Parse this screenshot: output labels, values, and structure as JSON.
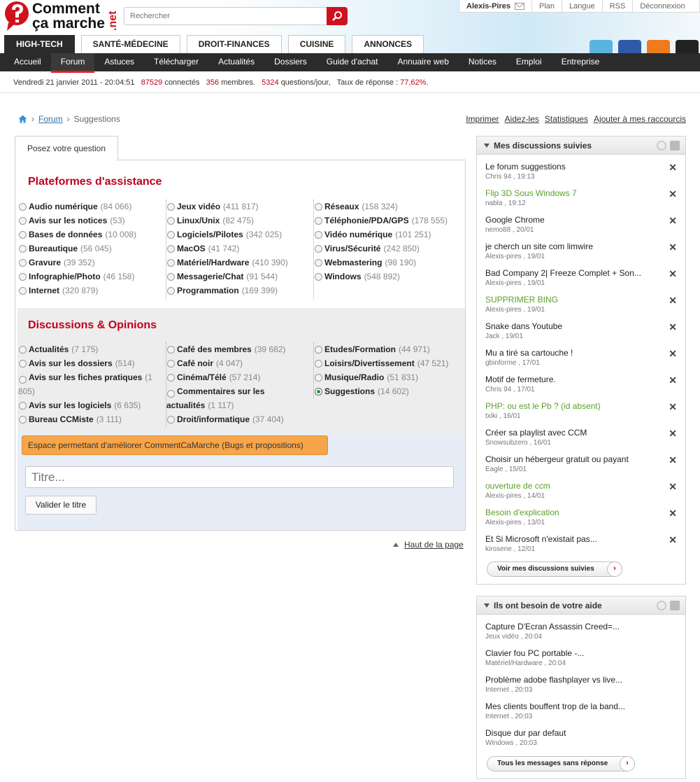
{
  "brand": {
    "line1": "Comment",
    "line2": "ça marche",
    ".net": ".net",
    "suffix": ".net"
  },
  "search": {
    "placeholder": "Rechercher"
  },
  "usermenu": {
    "user": "Alexis-Pires",
    "plan": "Plan",
    "langue": "Langue",
    "rss": "RSS",
    "logout": "Déconnexion"
  },
  "tabs": [
    "HIGH-TECH",
    "SANTÉ-MÉDECINE",
    "DROIT-FINANCES",
    "CUISINE",
    "ANNONCES"
  ],
  "nav": [
    "Accueil",
    "Forum",
    "Astuces",
    "Télécharger",
    "Actualités",
    "Dossiers",
    "Guide d'achat",
    "Annuaire web",
    "Notices",
    "Emploi",
    "Entreprise"
  ],
  "stats": {
    "date": "Vendredi 21 janvier 2011 - 20:04:51",
    "connected_n": "87529",
    "connected_l": "connectés",
    "members_n": "356",
    "members_l": "membres.",
    "q_n": "5324",
    "q_l": "questions/jour,",
    "rate_l": "Taux de réponse :",
    "rate_v": "77,62%."
  },
  "breadcrumb": {
    "forum": "Forum",
    "current": "Suggestions"
  },
  "tools": {
    "print": "Imprimer",
    "help": "Aidez-les",
    "stats": "Statistiques",
    "shortcut": "Ajouter à mes raccourcis"
  },
  "question_tab": "Posez votre question",
  "platforms": {
    "title": "Plateformes d'assistance",
    "cols": [
      [
        [
          "Audio numérique",
          "(84 066)"
        ],
        [
          "Avis sur les notices",
          "(53)"
        ],
        [
          "Bases de données",
          "(10 008)"
        ],
        [
          "Bureautique",
          "(56 045)"
        ],
        [
          "Gravure",
          "(39 352)"
        ],
        [
          "Infographie/Photo",
          "(46 158)"
        ],
        [
          "Internet",
          "(320 879)"
        ]
      ],
      [
        [
          "Jeux vidéo",
          "(411 817)"
        ],
        [
          "Linux/Unix",
          "(82 475)"
        ],
        [
          "Logiciels/Pilotes",
          "(342 025)"
        ],
        [
          "MacOS",
          "(41 742)"
        ],
        [
          "Matériel/Hardware",
          "(410 390)"
        ],
        [
          "Messagerie/Chat",
          "(91 544)"
        ],
        [
          "Programmation",
          "(169 399)"
        ]
      ],
      [
        [
          "Réseaux",
          "(158 324)"
        ],
        [
          "Téléphonie/PDA/GPS",
          "(178 555)"
        ],
        [
          "Vidéo numérique",
          "(101 251)"
        ],
        [
          "Virus/Sécurité",
          "(242 850)"
        ],
        [
          "Webmastering",
          "(98 190)"
        ],
        [
          "Windows",
          "(548 892)"
        ]
      ]
    ]
  },
  "discussions": {
    "title": "Discussions & Opinions",
    "c1": [
      [
        "Actualités",
        "(7 175)"
      ],
      [
        "Avis sur les dossiers",
        "(514)"
      ]
    ],
    "c1wrap": [
      "Avis sur les fiches pratiques",
      "(1 805)"
    ],
    "c1b": [
      [
        "Avis sur les logiciels",
        "(6 635)"
      ],
      [
        "Bureau CCMiste",
        "(3 111)"
      ]
    ],
    "c2": [
      [
        "Café des membres",
        "(39 682)"
      ],
      [
        "Café noir",
        "(4 047)"
      ],
      [
        "Cinéma/Télé",
        "(57 214)"
      ]
    ],
    "c2wrap": [
      "Commentaires sur les actualités",
      "(1 117)"
    ],
    "c2b": [
      [
        "Droit/informatique",
        "(37 404)"
      ]
    ],
    "c3": [
      [
        "Etudes/Formation",
        "(44 971)"
      ],
      [
        "Loisirs/Divertissement",
        "(47 521)"
      ],
      [
        "Musique/Radio",
        "(51 831)"
      ]
    ],
    "c3sel": [
      "Suggestions",
      "(14 602)"
    ]
  },
  "orange": "Espace permettant d'améliorer CommentCaMarche (Bugs et propositions)",
  "titre_placeholder": "Titre...",
  "valider": "Valider le titre",
  "haut": "Haut de la page",
  "followed": {
    "title": "Mes discussions suivies",
    "items": [
      [
        "Le forum suggestions",
        "Chris 94 , 19:13",
        false
      ],
      [
        "Flip 3D Sous Windows 7",
        "nabla , 19:12",
        true
      ],
      [
        "Google Chrome",
        "nemo88 , 20/01",
        false
      ],
      [
        "je cherch un site com limwire",
        "Alexis-pires , 19/01",
        false
      ],
      [
        "Bad Company 2| Freeze Complet + Son...",
        "Alexis-pires , 19/01",
        false
      ],
      [
        "SUPPRIMER BING",
        "Alexis-pires , 19/01",
        true
      ],
      [
        "Snake dans Youtube",
        "Jack , 19/01",
        false
      ],
      [
        "Mu a tiré sa cartouche !",
        "gbinforme , 17/01",
        false
      ],
      [
        "Motif de fermeture.",
        "Chris 94 , 17/01",
        false
      ],
      [
        "PHP: ou est le Pb ? (id absent)",
        "txiki , 16/01",
        true
      ],
      [
        "Créer sa playlist avec CCM",
        "Snowsubzero , 16/01",
        false
      ],
      [
        "Choisir un hébergeur gratuit ou payant",
        "Eagle , 15/01",
        false
      ],
      [
        "ouverture de ccm",
        "Alexis-pires , 14/01",
        true
      ],
      [
        "Besoin d'explication",
        "Alexis-pires , 13/01",
        true
      ],
      [
        "Et Si Microsoft n'existait pas...",
        "kirosene , 12/01",
        false
      ]
    ],
    "button": "Voir mes discussions suivies"
  },
  "help": {
    "title": "Ils ont besoin de votre aide",
    "items": [
      [
        "Capture D'Ecran Assassin Creed=...",
        "Jeux vidéo , 20:04"
      ],
      [
        "Clavier fou PC portable -...",
        "Matériel/Hardware , 20:04"
      ],
      [
        "Problème adobe flashplayer vs live...",
        "Internet , 20:03"
      ],
      [
        "Mes clients bouffent trop de la band...",
        "Internet , 20:03"
      ],
      [
        "Disque dur par defaut",
        "Windows , 20:03"
      ]
    ],
    "button": "Tous les messages sans réponse"
  },
  "colors": {
    "brand_red": "#d0121f",
    "green_link": "#5aa02c",
    "orange": "#f7a54a"
  }
}
